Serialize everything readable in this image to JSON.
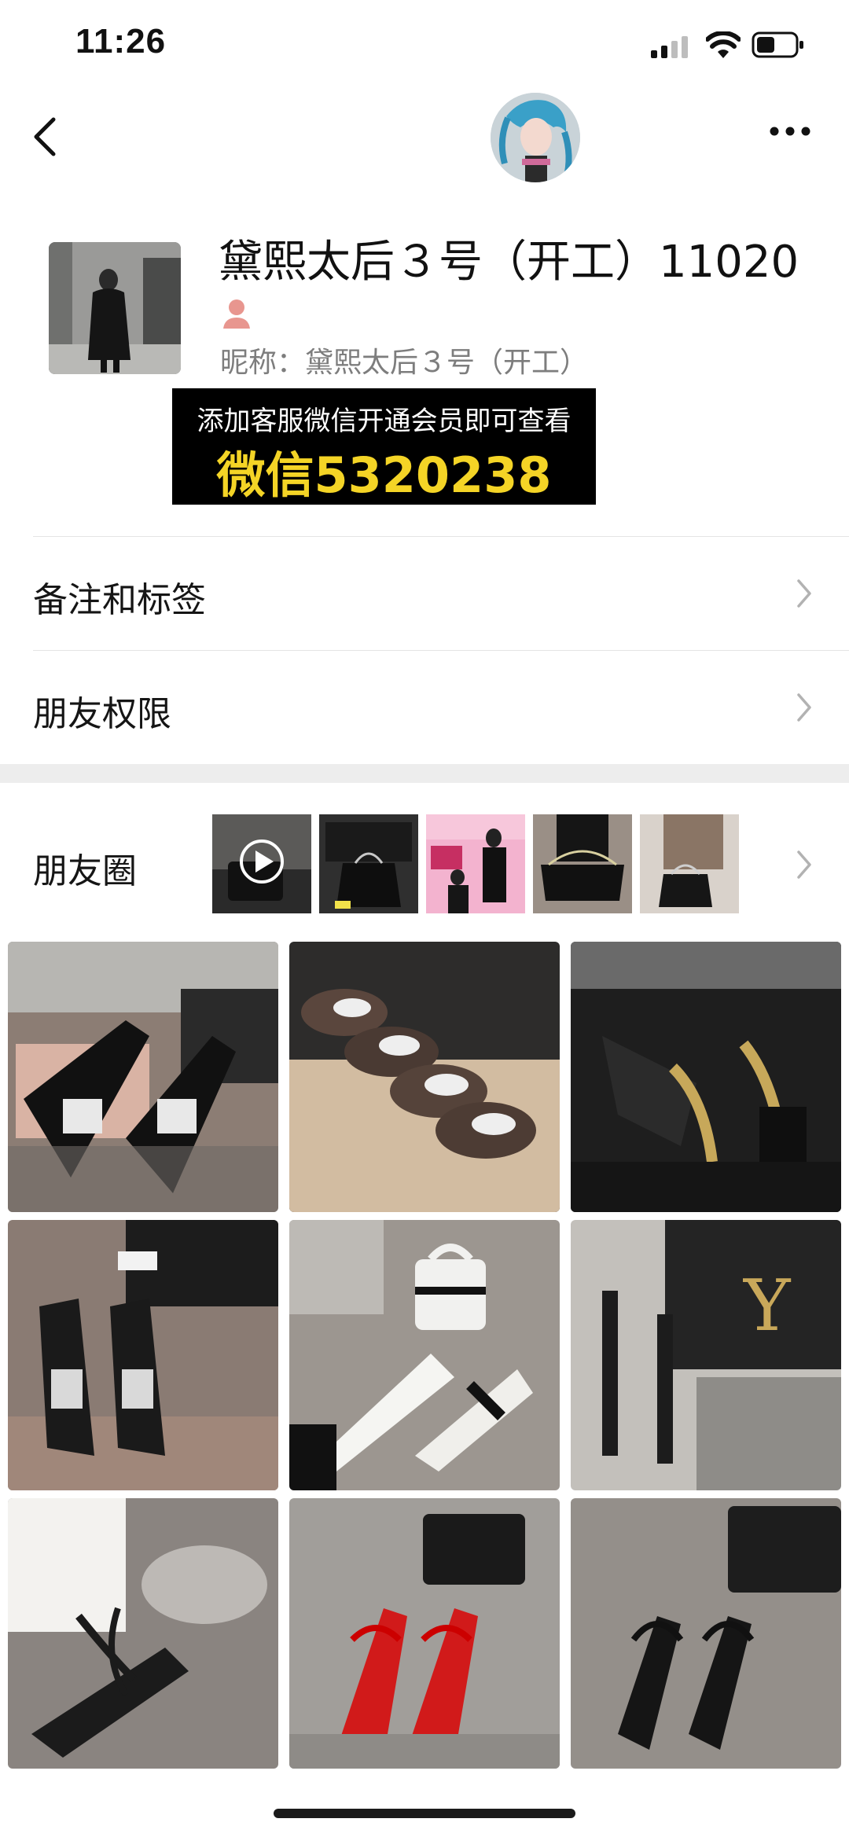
{
  "status_bar": {
    "time": "11:26"
  },
  "profile": {
    "name": "黛熙太后３号（开工）11020",
    "nickname": "昵称：黛熙太后３号（开工）"
  },
  "banner": {
    "line1": "添加客服微信开通会员即可查看",
    "line2": "微信5320238"
  },
  "menu": {
    "remarks_label": "备注和标签",
    "permissions_label": "朋友权限",
    "moments_label": "朋友圈"
  },
  "colors": {
    "banner_bg": "#000000",
    "banner_highlight": "#f4d426",
    "person_icon": "#e8968f",
    "secondary_text": "#7d7d7d"
  },
  "moments_thumbnails": [
    {
      "name": "video-thumbnail",
      "has_play": true
    },
    {
      "name": "bag-box-thumbnail",
      "has_play": false
    },
    {
      "name": "pink-poster-thumbnail",
      "has_play": false
    },
    {
      "name": "chain-bag-thumbnail",
      "has_play": false
    },
    {
      "name": "handbag-thumbnail",
      "has_play": false
    }
  ],
  "grid_items": [
    "crystal-buckle-pumps",
    "sneakers-row",
    "gold-sandals",
    "slingback-crystal-heels",
    "white-pointed-pumps",
    "ysl-bag-sandals",
    "black-strappy-sandals",
    "red-strappy-heels",
    "black-strappy-heels"
  ]
}
